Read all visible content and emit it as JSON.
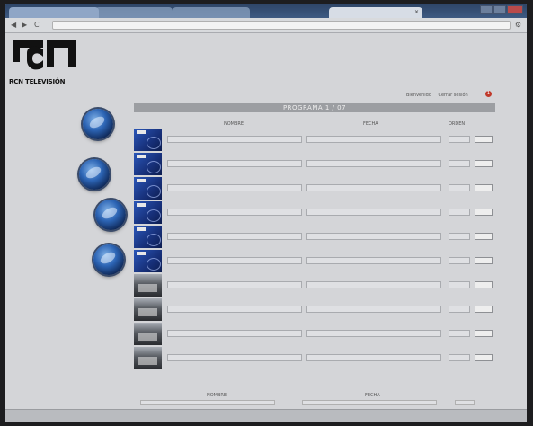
{
  "browser": {
    "tabs": [
      {
        "label": "",
        "active": false
      },
      {
        "label": "",
        "active": false
      },
      {
        "label": "",
        "active": false
      },
      {
        "label": "",
        "active": true
      }
    ],
    "url": "",
    "back_icon": "back-arrow-icon",
    "forward_icon": "forward-arrow-icon",
    "reload_icon": "reload-icon"
  },
  "header": {
    "logo_text": "RCN TELEVISIÓN",
    "user_links": [
      "Bienvenido",
      "Cerrar sesión"
    ],
    "alert_count": "1"
  },
  "sidebar": {
    "items": [
      {
        "label": "",
        "icon": "globe-icon"
      },
      {
        "label": "",
        "icon": "globe-icon"
      },
      {
        "label": "",
        "icon": "globe-icon"
      },
      {
        "label": "",
        "icon": "globe-icon"
      }
    ]
  },
  "panel": {
    "title": "PROGRAMA 1 / 07",
    "section_title": "",
    "columns": {
      "thumb": "",
      "name": "NOMBRE",
      "date": "FECHA",
      "order": "ORDEN"
    },
    "rows": [
      {
        "thumb": "blue",
        "name": "",
        "date": "",
        "order": "",
        "button": ""
      },
      {
        "thumb": "blue",
        "name": "",
        "date": "",
        "order": "",
        "button": ""
      },
      {
        "thumb": "blue",
        "name": "",
        "date": "",
        "order": "",
        "button": ""
      },
      {
        "thumb": "blue",
        "name": "",
        "date": "",
        "order": "",
        "button": ""
      },
      {
        "thumb": "blue",
        "name": "",
        "date": "",
        "order": "",
        "button": ""
      },
      {
        "thumb": "blue",
        "name": "",
        "date": "",
        "order": "",
        "button": ""
      },
      {
        "thumb": "photo",
        "name": "",
        "date": "",
        "order": "",
        "button": ""
      },
      {
        "thumb": "photo",
        "name": "",
        "date": "",
        "order": "",
        "button": ""
      },
      {
        "thumb": "photo",
        "name": "",
        "date": "",
        "order": "",
        "button": ""
      },
      {
        "thumb": "photo",
        "name": "",
        "date": "",
        "order": "",
        "button": ""
      }
    ]
  },
  "search": {
    "title": "",
    "columns": {
      "name": "NOMBRE",
      "date": "FECHA"
    }
  },
  "statusbar": {
    "left": "",
    "right": ""
  }
}
